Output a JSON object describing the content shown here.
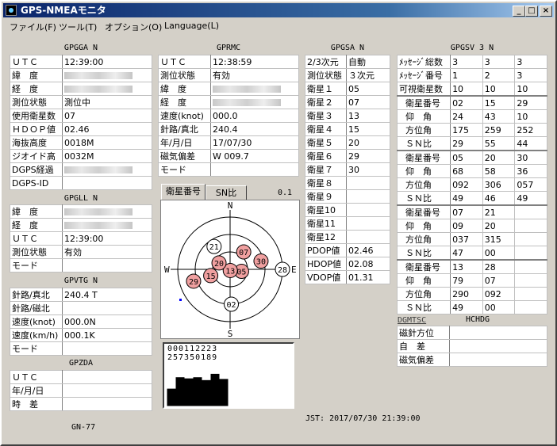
{
  "window": {
    "title": "GPS-NMEAモニタ",
    "btn_min": "_",
    "btn_max": "□",
    "btn_close": "×"
  },
  "menu": [
    "ファイル(F)",
    "ツール(T)",
    "オプション(O)",
    "Language(L)"
  ],
  "gpgga": {
    "header": "GPGGA N",
    "rows": [
      {
        "label": "ＵＴＣ",
        "value": "12:39:00"
      },
      {
        "label": "緯　度",
        "value": ""
      },
      {
        "label": "経　度",
        "value": ""
      },
      {
        "label": "測位状態",
        "value": "測位中"
      },
      {
        "label": "使用衛星数",
        "value": "07"
      },
      {
        "label": "ＨＤＯＰ値",
        "value": "02.46"
      },
      {
        "label": "海抜高度",
        "value": "0018M"
      },
      {
        "label": "ジオイド高",
        "value": "0032M"
      },
      {
        "label": "DGPS経過",
        "value": ""
      },
      {
        "label": "DGPS-ID",
        "value": ""
      }
    ]
  },
  "gpgll": {
    "header": "GPGLL N",
    "rows": [
      {
        "label": "緯　度",
        "value": ""
      },
      {
        "label": "経　度",
        "value": ""
      },
      {
        "label": "ＵＴＣ",
        "value": "12:39:00"
      },
      {
        "label": "測位状態",
        "value": "有効"
      },
      {
        "label": "モード",
        "value": ""
      }
    ]
  },
  "gpvtg": {
    "header": "GPVTG N",
    "rows": [
      {
        "label": "針路/真北",
        "value": "240.4 T"
      },
      {
        "label": "針路/磁北",
        "value": ""
      },
      {
        "label": "速度(knot)",
        "value": "000.0N"
      },
      {
        "label": "速度(km/h)",
        "value": "000.1K"
      },
      {
        "label": "モード",
        "value": ""
      }
    ]
  },
  "gpzda": {
    "header": "GPZDA",
    "rows": [
      {
        "label": "ＵＴＣ",
        "value": ""
      },
      {
        "label": "年/月/日",
        "value": ""
      },
      {
        "label": "時　差",
        "value": ""
      }
    ]
  },
  "gprmc": {
    "header": "GPRMC",
    "rows": [
      {
        "label": "ＵＴＣ",
        "value": "12:38:59"
      },
      {
        "label": "測位状態",
        "value": "有効"
      },
      {
        "label": "緯　度",
        "value": ""
      },
      {
        "label": "経　度",
        "value": ""
      },
      {
        "label": "速度(knot)",
        "value": "000.0"
      },
      {
        "label": "針路/真北",
        "value": "240.4"
      },
      {
        "label": "年/月/日",
        "value": "17/07/30"
      },
      {
        "label": "磁気偏差",
        "value": "W 009.7"
      },
      {
        "label": "モード",
        "value": ""
      }
    ]
  },
  "sky": {
    "tab1": "衛星番号",
    "tab2": "SN比",
    "version": "0.1",
    "north": "N",
    "south": "S",
    "east": "E",
    "west": "W",
    "sats": [
      {
        "id": "07",
        "az": 38,
        "el": 52,
        "used": true
      },
      {
        "id": "30",
        "az": 75,
        "el": 35,
        "used": true
      },
      {
        "id": "05",
        "az": 100,
        "el": 70,
        "used": true
      },
      {
        "id": "13",
        "az": 170,
        "el": 88,
        "used": true
      },
      {
        "id": "20",
        "az": 300,
        "el": 68,
        "used": true
      },
      {
        "id": "15",
        "az": 252,
        "el": 55,
        "used": true
      },
      {
        "id": "29",
        "az": 252,
        "el": 24,
        "used": true
      },
      {
        "id": "21",
        "az": 325,
        "el": 42,
        "used": false
      },
      {
        "id": "28",
        "az": 90,
        "el": 0,
        "used": false
      },
      {
        "id": "02",
        "az": 178,
        "el": 30,
        "used": false
      }
    ]
  },
  "snr": {
    "digits_top": "000112223",
    "digits_bottom": "257350189"
  },
  "gpgsa": {
    "header": "GPGSA N",
    "rows": [
      {
        "label": "2/3次元",
        "value": "自動"
      },
      {
        "label": "測位状態",
        "value": "３次元"
      },
      {
        "label": "衛星１",
        "value": "05"
      },
      {
        "label": "衛星２",
        "value": "07"
      },
      {
        "label": "衛星３",
        "value": "13"
      },
      {
        "label": "衛星４",
        "value": "15"
      },
      {
        "label": "衛星５",
        "value": "20"
      },
      {
        "label": "衛星６",
        "value": "29"
      },
      {
        "label": "衛星７",
        "value": "30"
      },
      {
        "label": "衛星８",
        "value": ""
      },
      {
        "label": "衛星９",
        "value": ""
      },
      {
        "label": "衛星10",
        "value": ""
      },
      {
        "label": "衛星11",
        "value": ""
      },
      {
        "label": "衛星12",
        "value": ""
      },
      {
        "label": "PDOP値",
        "value": "02.46"
      },
      {
        "label": "HDOP値",
        "value": "02.08"
      },
      {
        "label": "VDOP値",
        "value": "01.31"
      }
    ]
  },
  "gpgsv": {
    "header": "GPGSV 3 N",
    "top": [
      {
        "label": "ﾒｯｾｰｼﾞ総数",
        "v": [
          "3",
          "3",
          "3"
        ]
      },
      {
        "label": "ﾒｯｾｰｼﾞ番号",
        "v": [
          "1",
          "2",
          "3"
        ]
      },
      {
        "label": "可視衛星数",
        "v": [
          "10",
          "10",
          "10"
        ]
      }
    ],
    "groups": [
      [
        {
          "label": "衛星番号",
          "v": [
            "02",
            "15",
            "29"
          ]
        },
        {
          "label": "仰　角",
          "v": [
            "24",
            "43",
            "10"
          ]
        },
        {
          "label": "方位角",
          "v": [
            "175",
            "259",
            "252"
          ]
        },
        {
          "label": "ＳＮ比",
          "v": [
            "29",
            "55",
            "44"
          ]
        }
      ],
      [
        {
          "label": "衛星番号",
          "v": [
            "05",
            "20",
            "30"
          ]
        },
        {
          "label": "仰　角",
          "v": [
            "68",
            "58",
            "36"
          ]
        },
        {
          "label": "方位角",
          "v": [
            "092",
            "306",
            "057"
          ]
        },
        {
          "label": "ＳＮ比",
          "v": [
            "49",
            "46",
            "49"
          ]
        }
      ],
      [
        {
          "label": "衛星番号",
          "v": [
            "07",
            "21",
            ""
          ]
        },
        {
          "label": "仰　角",
          "v": [
            "09",
            "20",
            ""
          ]
        },
        {
          "label": "方位角",
          "v": [
            "037",
            "315",
            ""
          ]
        },
        {
          "label": "ＳＮ比",
          "v": [
            "47",
            "00",
            ""
          ]
        }
      ],
      [
        {
          "label": "衛星番号",
          "v": [
            "13",
            "28",
            ""
          ]
        },
        {
          "label": "仰　角",
          "v": [
            "79",
            "07",
            ""
          ]
        },
        {
          "label": "方位角",
          "v": [
            "290",
            "092",
            ""
          ]
        },
        {
          "label": "ＳＮ比",
          "v": [
            "49",
            "00",
            ""
          ]
        }
      ]
    ]
  },
  "hchdg": {
    "header": "HCHDG",
    "dgmtsc": "DGMTSC",
    "rows": [
      {
        "label": "磁針方位",
        "value": ""
      },
      {
        "label": "自　差",
        "value": ""
      },
      {
        "label": "磁気偏差",
        "value": ""
      }
    ]
  },
  "footer": {
    "model": "GN-77",
    "jst": "JST: 2017/07/30 21:39:00"
  },
  "colors": {
    "used_sat": "#f0a0a0",
    "sat_border": "#000",
    "bar": "#000"
  }
}
